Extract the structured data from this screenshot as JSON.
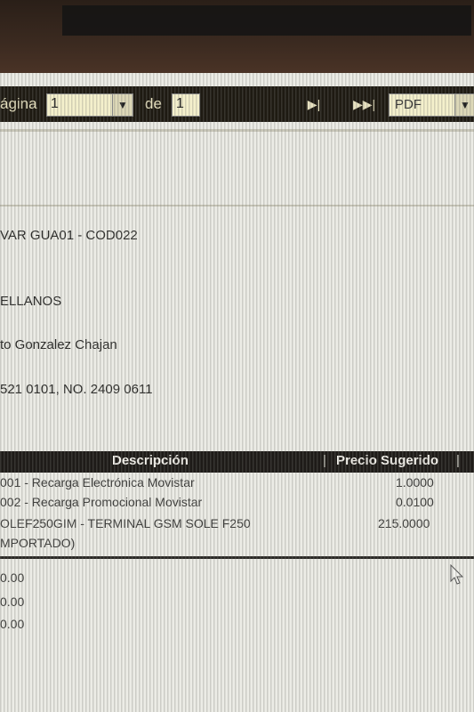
{
  "toolbar": {
    "page_label": "ágina",
    "page_value": "1",
    "of_label": "de",
    "total_pages": "1",
    "format_value": "PDF"
  },
  "header_fields": [
    "VAR GUA01 - COD022",
    "ELLANOS",
    "to Gonzalez Chajan",
    "521 0101, NO. 2409 0611"
  ],
  "table": {
    "headers": {
      "description": "Descripción",
      "suggested_price": "Precio Sugerido"
    },
    "rows": [
      {
        "description": "001 - Recarga Electrónica  Movistar",
        "price": "1.0000"
      },
      {
        "description": "002 - Recarga Promocional Movistar",
        "price": "0.0100"
      },
      {
        "description": "OLEF250GIM - TERMINAL GSM SOLE F250",
        "price": "215.0000"
      },
      {
        "description": "MPORTADO)",
        "price": ""
      }
    ]
  },
  "totals": [
    "0.00",
    "0.00",
    "0.00"
  ]
}
